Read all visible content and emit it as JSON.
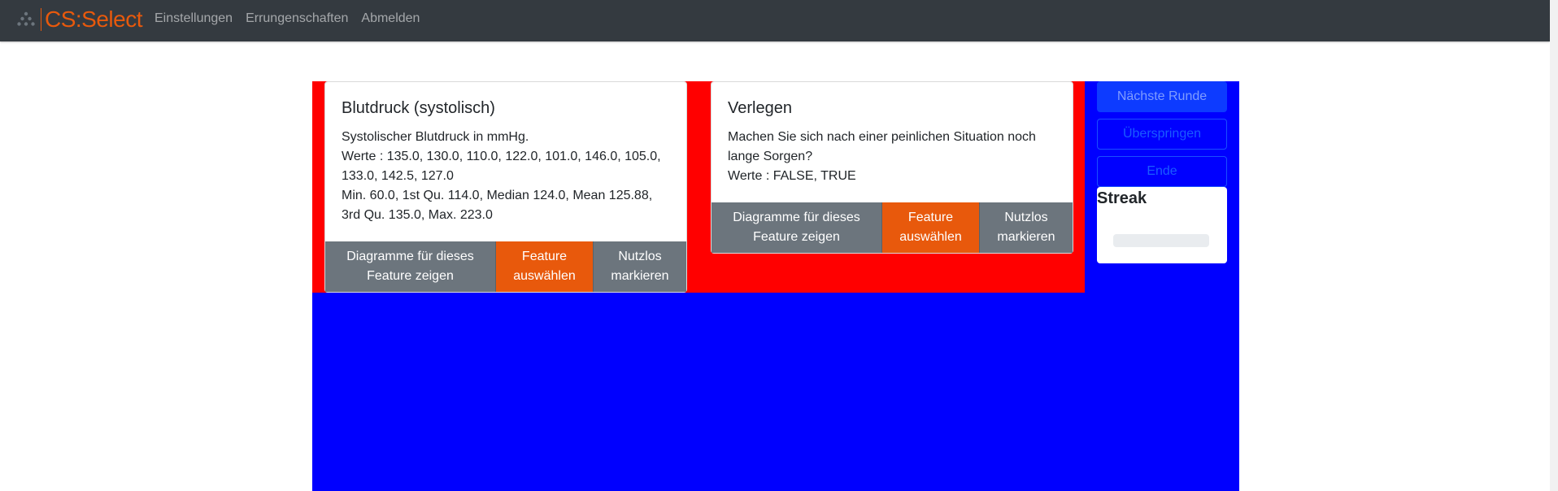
{
  "app": {
    "brand": "CS:Select",
    "brand_color": "#e8590c",
    "nav": [
      "Einstellungen",
      "Errungenschaften",
      "Abmelden"
    ]
  },
  "features": [
    {
      "title": "Blutdruck (systolisch)",
      "description": "Systolischer Blutdruck in mmHg.",
      "values": "Werte : 135.0, 130.0, 110.0, 122.0, 101.0, 146.0, 105.0, 133.0, 142.5, 127.0",
      "stats": "Min. 60.0, 1st Qu. 114.0, Median 124.0, Mean 125.88, 3rd Qu. 135.0, Max. 223.0",
      "buttons": {
        "charts": "Diagramme für dieses Feature zeigen",
        "select": "Feature auswählen",
        "useless": "Nutzlos markieren"
      }
    },
    {
      "title": "Verlegen",
      "description": "Machen Sie sich nach einer peinlichen Situation noch lange Sorgen?",
      "values": "Werte : FALSE, TRUE",
      "buttons": {
        "charts": "Diagramme für dieses Feature zeigen",
        "select": "Feature auswählen",
        "useless": "Nutzlos markieren"
      }
    }
  ],
  "sidebar": {
    "next_round": "Nächste Runde",
    "skip": "Überspringen",
    "end": "Ende",
    "streak_title": "Streak",
    "streak_progress": 0
  },
  "colors": {
    "highlight_red": "#ff0000",
    "highlight_blue": "#0000ff",
    "navbar": "#343a40"
  }
}
